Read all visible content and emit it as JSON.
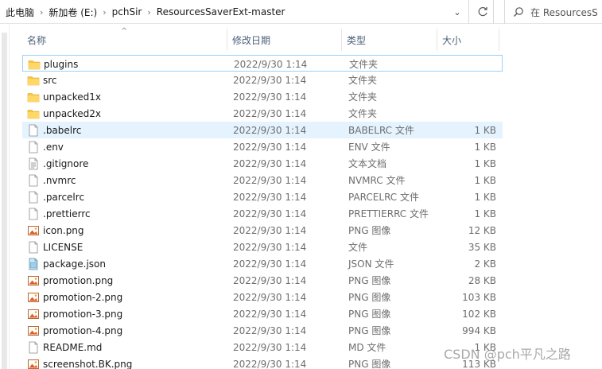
{
  "address": {
    "crumbs": [
      "此电脑",
      "新加卷 (E:)",
      "pchSir",
      "ResourcesSaverExt-master"
    ],
    "search_placeholder": "在 ResourcesS"
  },
  "columns": {
    "name": "名称",
    "date": "修改日期",
    "type": "类型",
    "size": "大小"
  },
  "files": [
    {
      "name": "plugins",
      "date": "2022/9/30 1:14",
      "type": "文件夹",
      "size": "",
      "icon": "folder-icon"
    },
    {
      "name": "src",
      "date": "2022/9/30 1:14",
      "type": "文件夹",
      "size": "",
      "icon": "folder-icon"
    },
    {
      "name": "unpacked1x",
      "date": "2022/9/30 1:14",
      "type": "文件夹",
      "size": "",
      "icon": "folder-icon"
    },
    {
      "name": "unpacked2x",
      "date": "2022/9/30 1:14",
      "type": "文件夹",
      "size": "",
      "icon": "folder-icon"
    },
    {
      "name": ".babelrc",
      "date": "2022/9/30 1:14",
      "type": "BABELRC 文件",
      "size": "1 KB",
      "icon": "file-icon"
    },
    {
      "name": ".env",
      "date": "2022/9/30 1:14",
      "type": "ENV 文件",
      "size": "1 KB",
      "icon": "file-icon"
    },
    {
      "name": ".gitignore",
      "date": "2022/9/30 1:14",
      "type": "文本文档",
      "size": "1 KB",
      "icon": "text-file-icon"
    },
    {
      "name": ".nvmrc",
      "date": "2022/9/30 1:14",
      "type": "NVMRC 文件",
      "size": "1 KB",
      "icon": "file-icon"
    },
    {
      "name": ".parcelrc",
      "date": "2022/9/30 1:14",
      "type": "PARCELRC 文件",
      "size": "1 KB",
      "icon": "file-icon"
    },
    {
      "name": ".prettierrc",
      "date": "2022/9/30 1:14",
      "type": "PRETTIERRC 文件",
      "size": "1 KB",
      "icon": "file-icon"
    },
    {
      "name": "icon.png",
      "date": "2022/9/30 1:14",
      "type": "PNG 图像",
      "size": "12 KB",
      "icon": "image-file-icon"
    },
    {
      "name": "LICENSE",
      "date": "2022/9/30 1:14",
      "type": "文件",
      "size": "35 KB",
      "icon": "file-icon"
    },
    {
      "name": "package.json",
      "date": "2022/9/30 1:14",
      "type": "JSON 文件",
      "size": "2 KB",
      "icon": "json-file-icon"
    },
    {
      "name": "promotion.png",
      "date": "2022/9/30 1:14",
      "type": "PNG 图像",
      "size": "28 KB",
      "icon": "image-file-icon"
    },
    {
      "name": "promotion-2.png",
      "date": "2022/9/30 1:14",
      "type": "PNG 图像",
      "size": "103 KB",
      "icon": "image-file-icon"
    },
    {
      "name": "promotion-3.png",
      "date": "2022/9/30 1:14",
      "type": "PNG 图像",
      "size": "102 KB",
      "icon": "image-file-icon"
    },
    {
      "name": "promotion-4.png",
      "date": "2022/9/30 1:14",
      "type": "PNG 图像",
      "size": "994 KB",
      "icon": "image-file-icon"
    },
    {
      "name": "README.md",
      "date": "2022/9/30 1:14",
      "type": "MD 文件",
      "size": "1 KB",
      "icon": "file-icon"
    },
    {
      "name": "screenshot.BK.png",
      "date": "2022/9/30 1:14",
      "type": "PNG 图像",
      "size": "113 KB",
      "icon": "image-file-icon"
    }
  ],
  "focused_row": 0,
  "selected_row": 4,
  "watermark": "CSDN @pch平凡之路",
  "colors": {
    "folder": "#f4c542",
    "selection": "#e5f3ff",
    "focus_border": "#99d1ff",
    "header_text": "#4c607a"
  }
}
